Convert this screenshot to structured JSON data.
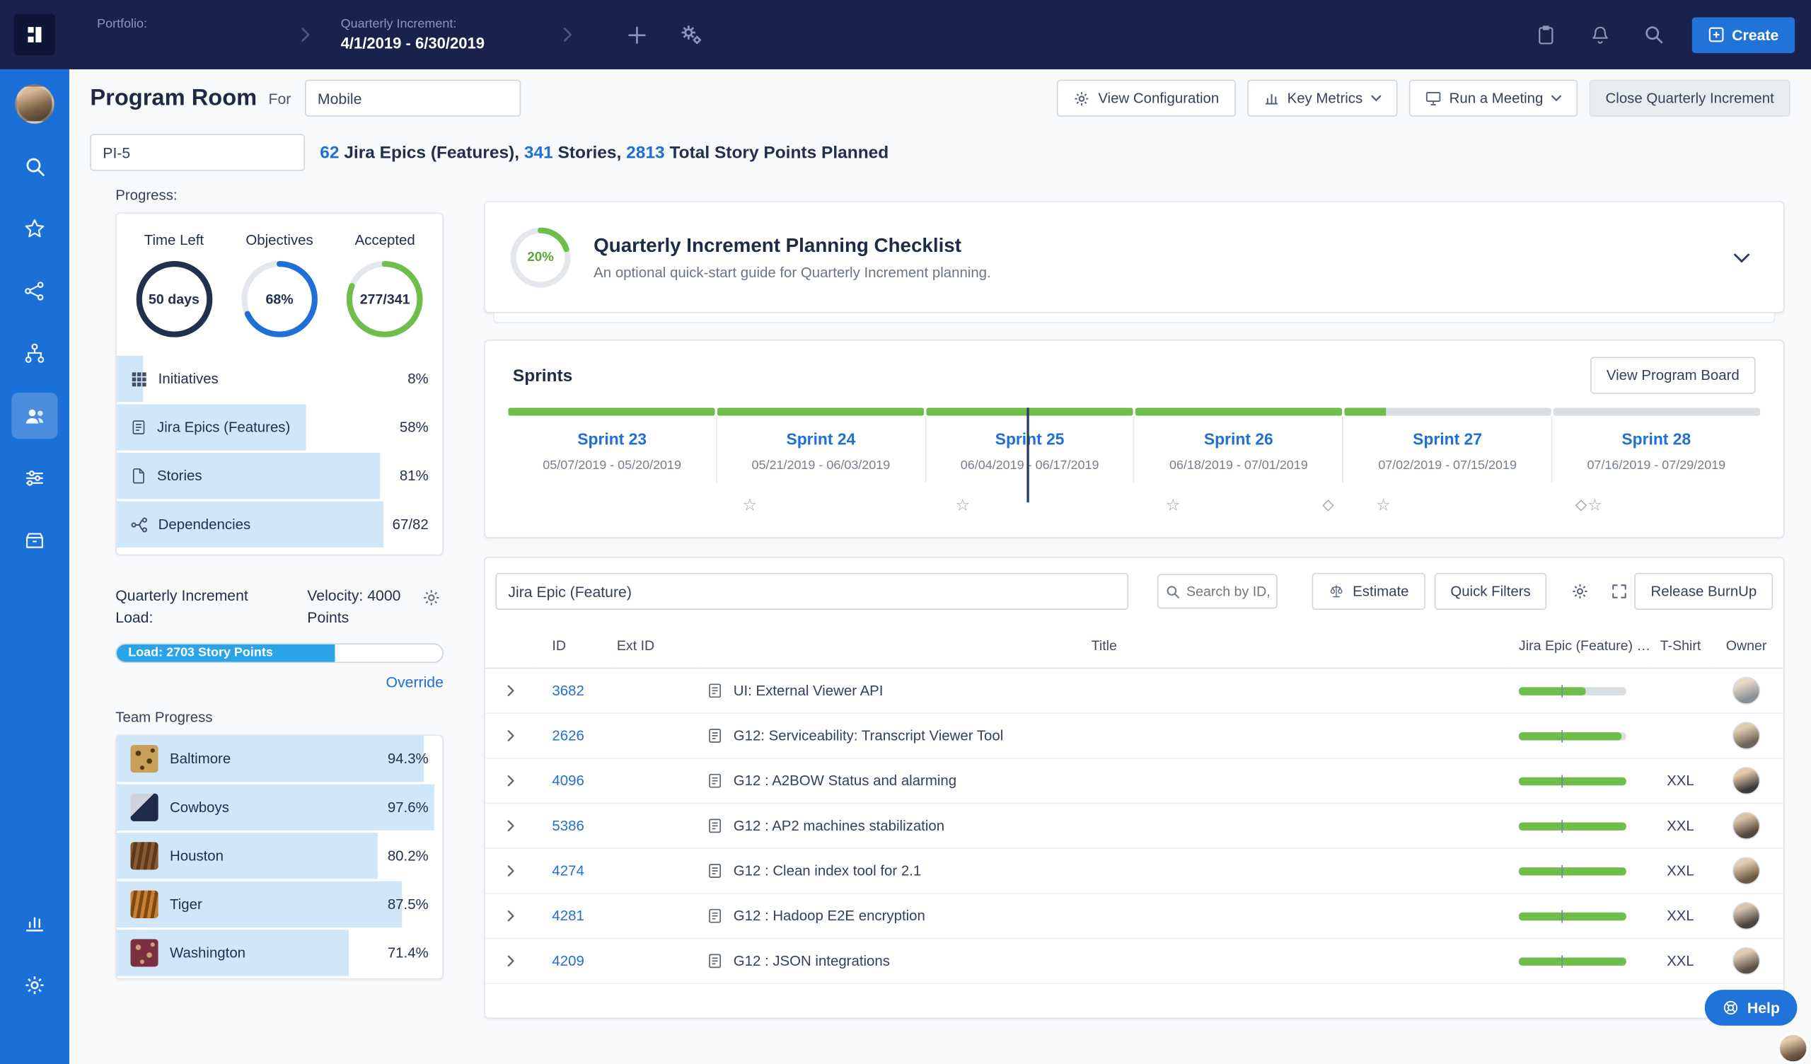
{
  "colors": {
    "accent": "#1f6fd6",
    "green": "#6fbe4b",
    "light_blue": "#cfe7f8",
    "topbar_navy": "#19224d",
    "sidebar_blue": "#1b70d7",
    "load_blue": "#2ba3e8"
  },
  "topbar": {
    "portfolio_label": "Portfolio:",
    "portfolio_value": "",
    "qi_label": "Quarterly Increment:",
    "qi_value": "4/1/2019 - 6/30/2019",
    "create_label": "Create"
  },
  "header": {
    "title": "Program Room",
    "for_label": "For",
    "program_value": "Mobile",
    "view_configuration": "View Configuration",
    "key_metrics": "Key Metrics",
    "run_a_meeting": "Run a Meeting",
    "close_qi": "Close Quarterly Increment"
  },
  "summary": {
    "pi_value": "PI-5",
    "epics_count": "62",
    "epics_label": "Jira Epics (Features),",
    "stories_count": "341",
    "stories_label": "Stories,",
    "points_count": "2813",
    "points_label": "Total Story Points Planned"
  },
  "progress_panel": {
    "heading": "Progress:",
    "dials": [
      {
        "label": "Time Left",
        "value": "50 days",
        "percent": 100,
        "color": "#22304e"
      },
      {
        "label": "Objectives",
        "value": "68%",
        "percent": 68,
        "color": "#1f6fd6"
      },
      {
        "label": "Accepted",
        "value": "277/341",
        "percent": 81,
        "color": "#6fbe4b"
      }
    ],
    "rows": [
      {
        "label": "Initiatives",
        "value": "8%",
        "fill": 8,
        "icon": "grid"
      },
      {
        "label": "Jira Epics (Features)",
        "value": "58%",
        "fill": 58,
        "icon": "document"
      },
      {
        "label": "Stories",
        "value": "81%",
        "fill": 81,
        "icon": "story"
      },
      {
        "label": "Dependencies",
        "value": "67/82",
        "fill": 82,
        "icon": "dependency"
      }
    ],
    "load": {
      "label": "Quarterly Increment Load:",
      "velocity": "Velocity: 4000 Points",
      "bar_label": "Load: 2703 Story Points",
      "bar_percent": 67,
      "override_label": "Override"
    },
    "team": {
      "heading": "Team Progress",
      "rows": [
        {
          "name": "Baltimore",
          "value": "94.3%",
          "percent": 94.3,
          "pattern": "dots",
          "c1": "#c9a05a",
          "c2": "#53380f"
        },
        {
          "name": "Cowboys",
          "value": "97.6%",
          "percent": 97.6,
          "pattern": "split",
          "c1": "#1e2a4a",
          "c2": "#cfd4dc"
        },
        {
          "name": "Houston",
          "value": "80.2%",
          "percent": 80.2,
          "pattern": "stripes",
          "c1": "#8a5a33",
          "c2": "#5e3a1c"
        },
        {
          "name": "Tiger",
          "value": "87.5%",
          "percent": 87.5,
          "pattern": "stripes",
          "c1": "#c97f35",
          "c2": "#7c4a12"
        },
        {
          "name": "Washington",
          "value": "71.4%",
          "percent": 71.4,
          "pattern": "dots",
          "c1": "#7c2f3e",
          "c2": "#caa27a"
        }
      ]
    }
  },
  "checklist": {
    "value": "20%",
    "percent": 20,
    "title": "Quarterly Increment Planning Checklist",
    "subtitle": "An optional quick-start guide for Quarterly Increment planning."
  },
  "sprints": {
    "heading": "Sprints",
    "view_board_label": "View Program Board",
    "today_pct": 41.4,
    "items": [
      {
        "name": "Sprint 23",
        "dates": "05/07/2019 - 05/20/2019",
        "progress": 100
      },
      {
        "name": "Sprint 24",
        "dates": "05/21/2019 - 06/03/2019",
        "progress": 100
      },
      {
        "name": "Sprint 25",
        "dates": "06/04/2019 - 06/17/2019",
        "progress": 100
      },
      {
        "name": "Sprint 26",
        "dates": "06/18/2019 - 07/01/2019",
        "progress": 100
      },
      {
        "name": "Sprint 27",
        "dates": "07/02/2019 - 07/15/2019",
        "progress": 20
      },
      {
        "name": "Sprint 28",
        "dates": "07/16/2019 - 07/29/2019",
        "progress": 0
      }
    ],
    "markers": [
      {
        "type": "star",
        "pos": 19.3
      },
      {
        "type": "star",
        "pos": 36.3
      },
      {
        "type": "star",
        "pos": 53.1
      },
      {
        "type": "diamond",
        "pos": 65.5
      },
      {
        "type": "star",
        "pos": 69.9
      },
      {
        "type": "diamond",
        "pos": 85.7
      },
      {
        "type": "star",
        "pos": 86.8
      }
    ]
  },
  "table": {
    "filter_value": "Jira Epic (Feature)",
    "search_placeholder": "Search by ID, Na",
    "estimate_label": "Estimate",
    "quick_filters_label": "Quick Filters",
    "release_burnup_label": "Release BurnUp",
    "columns": [
      "",
      "ID",
      "Ext ID",
      "Title",
      "Jira Epic (Feature) P...",
      "T-Shirt",
      "Owner"
    ],
    "rows": [
      {
        "id": "3682",
        "ext_id": "",
        "title": "UI: External Viewer API",
        "progress": 62,
        "tshirt": "",
        "avatar": [
          "#e8d9c4",
          "#8a8f96"
        ]
      },
      {
        "id": "2626",
        "ext_id": "",
        "title": "G12: Serviceability: Transcript Viewer Tool",
        "progress": 96,
        "tshirt": "",
        "avatar": [
          "#dfcbb0",
          "#6c6458"
        ]
      },
      {
        "id": "4096",
        "ext_id": "",
        "title": "G12 : A2BOW Status and alarming",
        "progress": 100,
        "tshirt": "XXL",
        "avatar": [
          "#e6c9a8",
          "#3c3c3c"
        ]
      },
      {
        "id": "5386",
        "ext_id": "",
        "title": "G12 : AP2 machines stabilization",
        "progress": 100,
        "tshirt": "XXL",
        "avatar": [
          "#d9c2a6",
          "#54483c"
        ]
      },
      {
        "id": "4274",
        "ext_id": "",
        "title": "G12 : Clean index tool for 2.1",
        "progress": 100,
        "tshirt": "XXL",
        "avatar": [
          "#e2cdb2",
          "#6e5a44"
        ]
      },
      {
        "id": "4281",
        "ext_id": "",
        "title": "G12 : Hadoop E2E encryption",
        "progress": 100,
        "tshirt": "XXL",
        "avatar": [
          "#d8c4ae",
          "#4a4440"
        ]
      },
      {
        "id": "4209",
        "ext_id": "",
        "title": "G12 : JSON integrations",
        "progress": 100,
        "tshirt": "XXL",
        "avatar": [
          "#e0ccb4",
          "#5c5248"
        ]
      }
    ]
  },
  "help": {
    "label": "Help"
  }
}
